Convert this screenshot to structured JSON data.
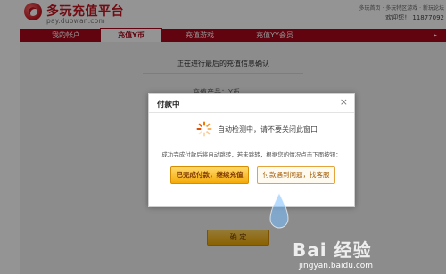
{
  "header": {
    "brand": "多玩充值平台",
    "domain": "pay.duowan.com",
    "top_links": "多玩首页 · 多玩特区游戏 · 新玩论坛",
    "welcome": "欢迎您！ 11877092"
  },
  "nav": {
    "items": [
      {
        "label": "我的帐户",
        "active": false
      },
      {
        "label": "充值Y币",
        "active": true
      },
      {
        "label": "充值游戏",
        "active": false
      },
      {
        "label": "充值YY会员",
        "active": false
      }
    ]
  },
  "content": {
    "confirm_title": "正在进行最后的充值信息确认",
    "product_line": "充值产品：Y币",
    "confirm_button": "确 定"
  },
  "modal": {
    "title": "付款中",
    "close_symbol": "×",
    "status": "自动检测中，请不要关闭此窗口",
    "note": "成功完成付款后将自动跳转，若未跳转，根据您的情况点击下面按钮：",
    "primary_button": "已完成付款，继续充值",
    "secondary_button": "付款遇到问题，找客服"
  },
  "watermark": {
    "brand": "Bai 经验",
    "url": "jingyan.baidu.com"
  },
  "colors": {
    "brand_red": "#c4131f",
    "nav_red": "#a8071a",
    "button_gold": "#f5aa07"
  }
}
